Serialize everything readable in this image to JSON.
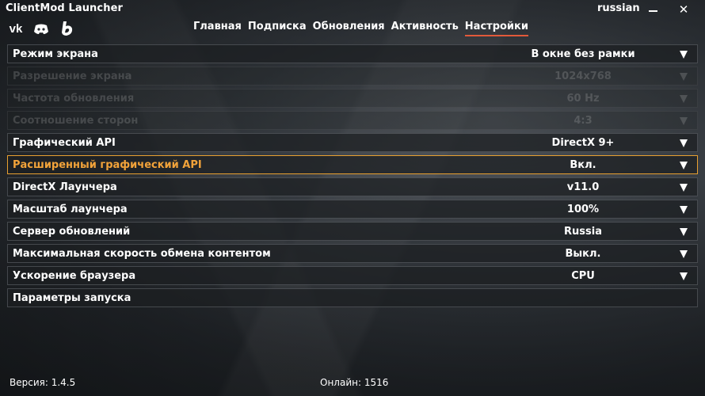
{
  "window": {
    "title": "ClientMod Launcher",
    "language": "russian",
    "minimize_icon": "minimize-icon",
    "close_icon": "close-icon",
    "close_glyph": "✕"
  },
  "social": {
    "vk": "vk",
    "discord_icon": "discord-icon",
    "b_icon": "b-logo-icon"
  },
  "nav": {
    "tabs": [
      {
        "label": "Главная"
      },
      {
        "label": "Подписка"
      },
      {
        "label": "Обновления"
      },
      {
        "label": "Активность"
      },
      {
        "label": "Настройки"
      }
    ],
    "active_tab": "Настройки",
    "active_color": "#e2593a"
  },
  "settings": {
    "rows": [
      {
        "label": "Режим экрана",
        "value": "В окне без рамки"
      },
      {
        "label": "Разрешение экрана",
        "value": "1024x768"
      },
      {
        "label": "Частота обновления",
        "value": "60 Hz"
      },
      {
        "label": "Соотношение сторон",
        "value": "4:3"
      },
      {
        "label": "Графический API",
        "value": "DirectX 9+"
      },
      {
        "label": "Расширенный графический API",
        "value": "Вкл."
      },
      {
        "label": "DirectX Лаунчера",
        "value": "v11.0"
      },
      {
        "label": "Масштаб лаунчера",
        "value": "100%"
      },
      {
        "label": "Сервер обновлений",
        "value": "Russia"
      },
      {
        "label": "Максимальная скорость обмена контентом",
        "value": "Выкл."
      },
      {
        "label": "Ускорение браузера",
        "value": "CPU"
      },
      {
        "label": "Параметры запуска"
      }
    ],
    "highlight_color": "#e8a030",
    "dropdown_icon": "dropdown-arrow-icon"
  },
  "footer": {
    "version": "Версия: 1.4.5",
    "online": "Онлайн: 1516"
  }
}
